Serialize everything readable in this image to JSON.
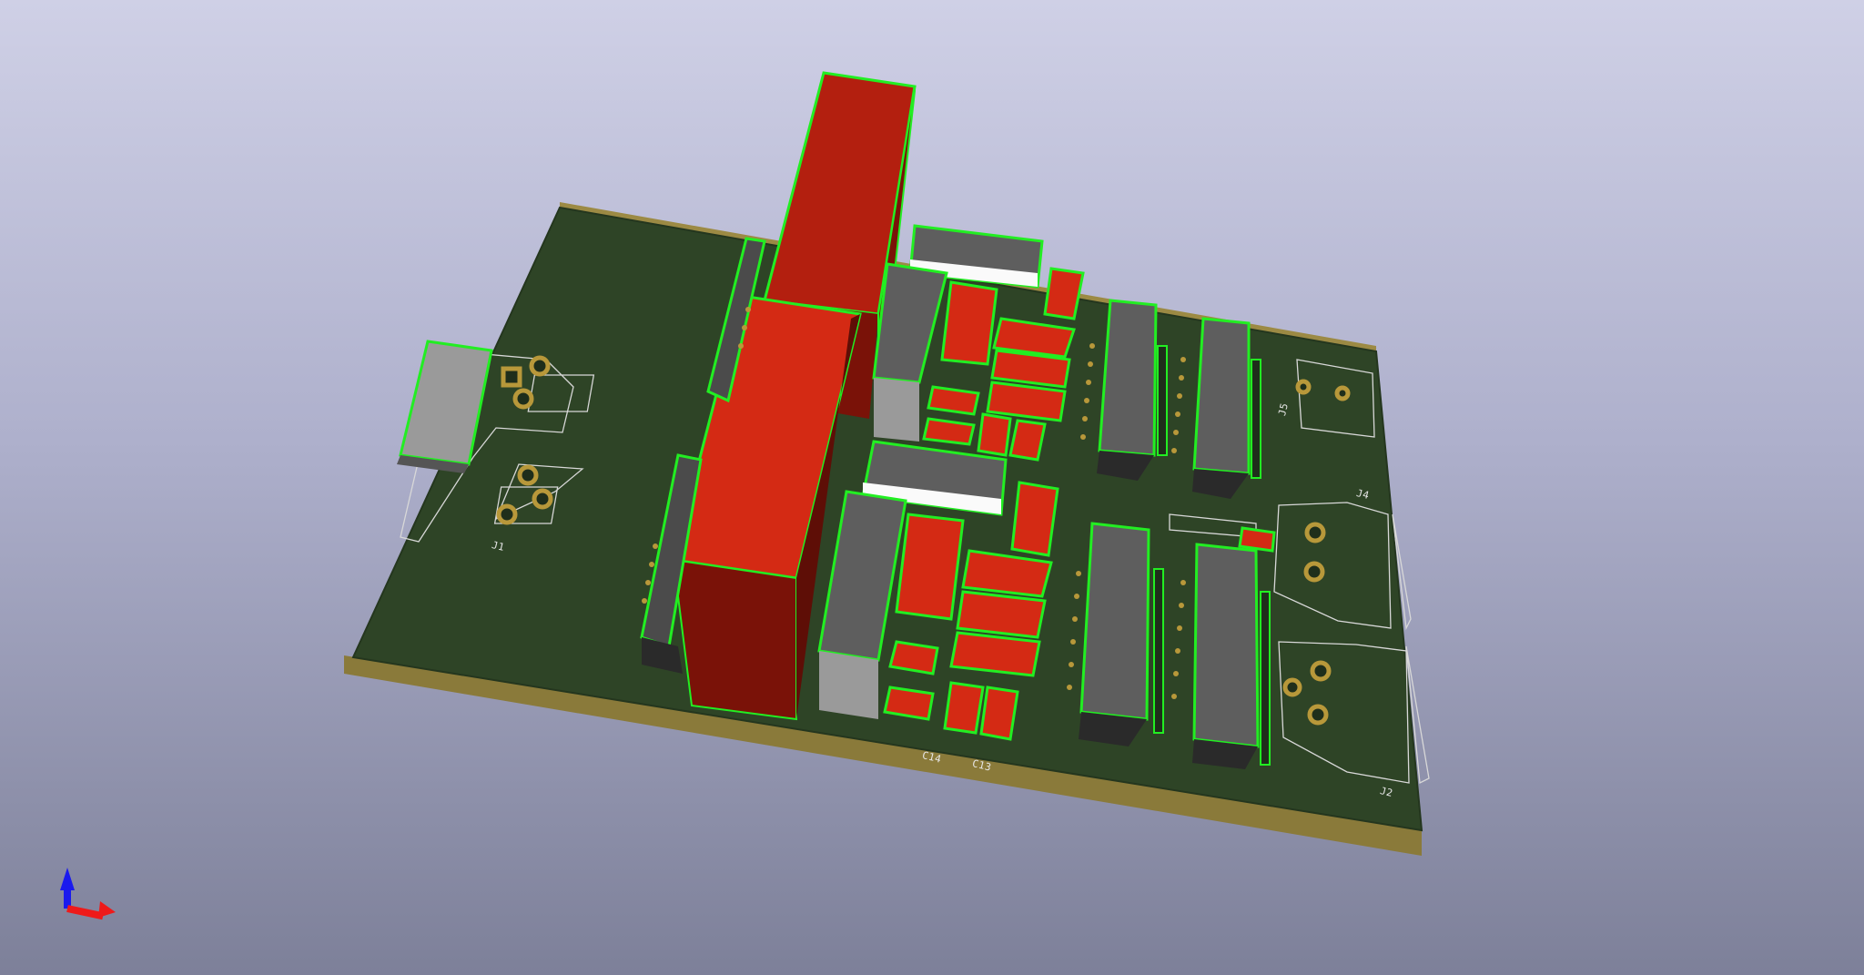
{
  "colors": {
    "board": "#2e4426",
    "board_edge": "#8a7a3a",
    "component_red": "#d42a14",
    "component_red_dark": "#7a1208",
    "component_gray": "#5e5e5e",
    "component_gray_dark": "#2a2a2a",
    "outline_green": "#22ee22",
    "pad_gold": "#b8983a",
    "silkscreen": "#e6e6e6"
  },
  "silkscreen_labels": {
    "j1": "J1",
    "j2": "J2",
    "j4": "J4",
    "j5": "J5",
    "c14": "C14",
    "c13": "C13"
  },
  "axis_gizmo": {
    "z_axis_color": "#1a1aee",
    "x_axis_color": "#ee1a1a"
  }
}
